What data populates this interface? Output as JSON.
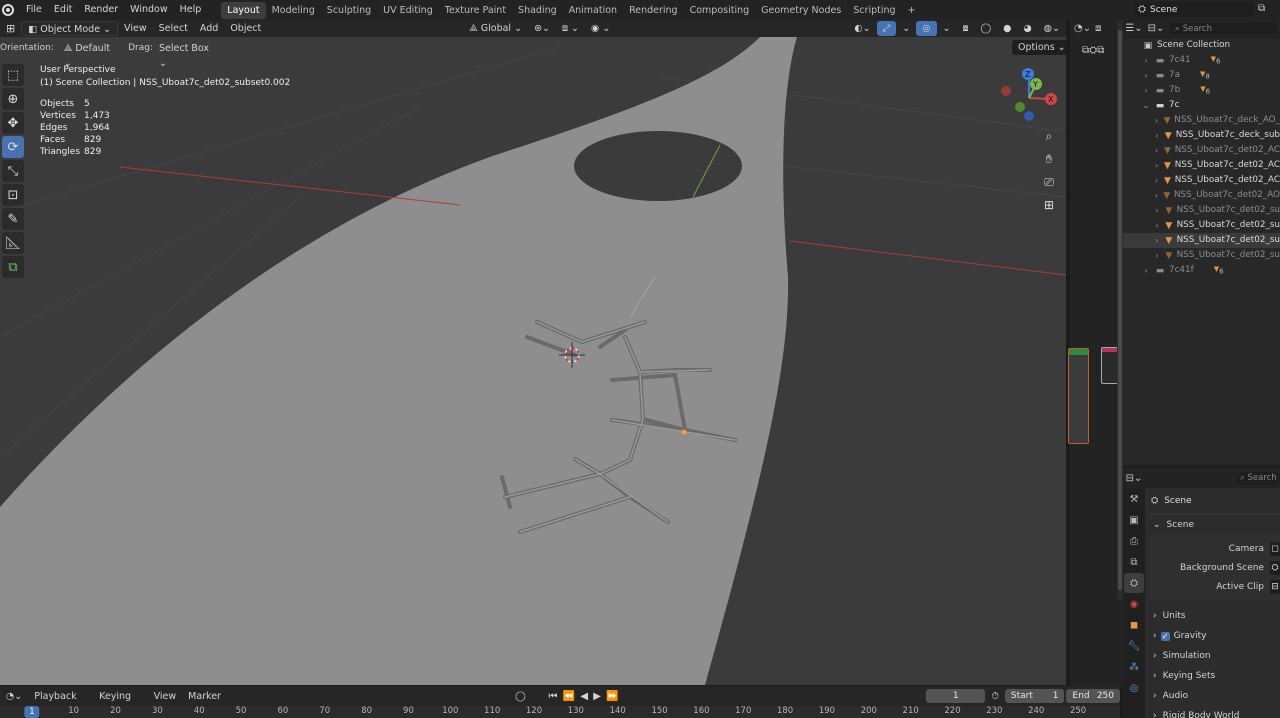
{
  "top_menu": [
    "File",
    "Edit",
    "Render",
    "Window",
    "Help"
  ],
  "workspaces": [
    "Layout",
    "Modeling",
    "Sculpting",
    "UV Editing",
    "Texture Paint",
    "Shading",
    "Animation",
    "Rendering",
    "Compositing",
    "Geometry Nodes",
    "Scripting"
  ],
  "active_workspace": "Layout",
  "add_workspace": "+",
  "scene_name": "Scene",
  "viewport_header": {
    "mode": "Object Mode",
    "menus": [
      "View",
      "Select",
      "Add",
      "Object"
    ],
    "transform": "Global",
    "options": "Options"
  },
  "tool_settings": {
    "orientation_label": "Orientation:",
    "orientation_value": "Default",
    "drag_label": "Drag:",
    "drag_value": "Select Box"
  },
  "overlay": {
    "perspective": "User Perspective",
    "collection": "(1) Scene Collection | NSS_Uboat7c_det02_subset0.002",
    "stats": [
      {
        "label": "Objects",
        "value": "5"
      },
      {
        "label": "Vertices",
        "value": "1,473"
      },
      {
        "label": "Edges",
        "value": "1,964"
      },
      {
        "label": "Faces",
        "value": "829"
      },
      {
        "label": "Triangles",
        "value": "829"
      }
    ]
  },
  "gizmo": {
    "x": "X",
    "y": "Y",
    "z": "Z"
  },
  "outliner": {
    "search_placeholder": "Search",
    "root": "Scene Collection",
    "items": [
      {
        "label": "7c41",
        "count": "6",
        "depth": 1,
        "expanded": false,
        "kind": "collection",
        "dim": true
      },
      {
        "label": "7a",
        "count": "8",
        "depth": 1,
        "expanded": false,
        "kind": "collection",
        "dim": true
      },
      {
        "label": "7b",
        "count": "6",
        "depth": 1,
        "expanded": false,
        "kind": "collection",
        "dim": true
      },
      {
        "label": "7c",
        "count": "",
        "depth": 1,
        "expanded": true,
        "kind": "collection",
        "dim": false
      },
      {
        "label": "NSS_Uboat7c_deck_AO_",
        "count": "",
        "depth": 2,
        "kind": "mesh",
        "dim": true
      },
      {
        "label": "NSS_Uboat7c_deck_sub",
        "count": "",
        "depth": 2,
        "kind": "mesh",
        "dim": false
      },
      {
        "label": "NSS_Uboat7c_det02_AC",
        "count": "",
        "depth": 2,
        "kind": "mesh",
        "dim": true
      },
      {
        "label": "NSS_Uboat7c_det02_AC",
        "count": "",
        "depth": 2,
        "kind": "mesh",
        "dim": false
      },
      {
        "label": "NSS_Uboat7c_det02_AC",
        "count": "",
        "depth": 2,
        "kind": "mesh",
        "dim": false
      },
      {
        "label": "NSS_Uboat7c_det02_AO",
        "count": "",
        "depth": 2,
        "kind": "mesh",
        "dim": true
      },
      {
        "label": "NSS_Uboat7c_det02_su",
        "count": "",
        "depth": 2,
        "kind": "mesh",
        "dim": true
      },
      {
        "label": "NSS_Uboat7c_det02_su",
        "count": "",
        "depth": 2,
        "kind": "mesh",
        "dim": false
      },
      {
        "label": "NSS_Uboat7c_det02_su",
        "count": "",
        "depth": 2,
        "kind": "mesh",
        "dim": false,
        "selected": true
      },
      {
        "label": "NSS_Uboat7c_det02_su",
        "count": "",
        "depth": 2,
        "kind": "mesh",
        "dim": true
      },
      {
        "label": "7c41f",
        "count": "6",
        "depth": 1,
        "expanded": false,
        "kind": "collection",
        "dim": true
      }
    ]
  },
  "properties": {
    "search_placeholder": "Search",
    "title": "Scene",
    "panel": "Scene",
    "fields": [
      {
        "label": "Camera"
      },
      {
        "label": "Background Scene"
      },
      {
        "label": "Active Clip"
      }
    ],
    "sections": [
      "Units",
      "Gravity",
      "Simulation",
      "Keying Sets",
      "Audio",
      "Rigid Body World"
    ],
    "gravity_checked": true
  },
  "timeline": {
    "menus": [
      "Playback",
      "Keying",
      "View",
      "Marker"
    ],
    "current_frame": "1",
    "start_label": "Start",
    "start_value": "1",
    "end_label": "End",
    "end_value": "250",
    "ticks": [
      "1",
      "10",
      "20",
      "30",
      "40",
      "50",
      "60",
      "70",
      "80",
      "90",
      "100",
      "110",
      "120",
      "130",
      "140",
      "150",
      "160",
      "170",
      "180",
      "190",
      "200",
      "210",
      "220",
      "230",
      "240",
      "250"
    ]
  },
  "colors": {
    "accent": "#4772b3",
    "viewport_bg": "#3b3b3b",
    "plane": "#8e8e8e",
    "x_axis": "#b13a3a",
    "y_axis": "#6ea33c",
    "mesh_icon": "#e8953f"
  }
}
